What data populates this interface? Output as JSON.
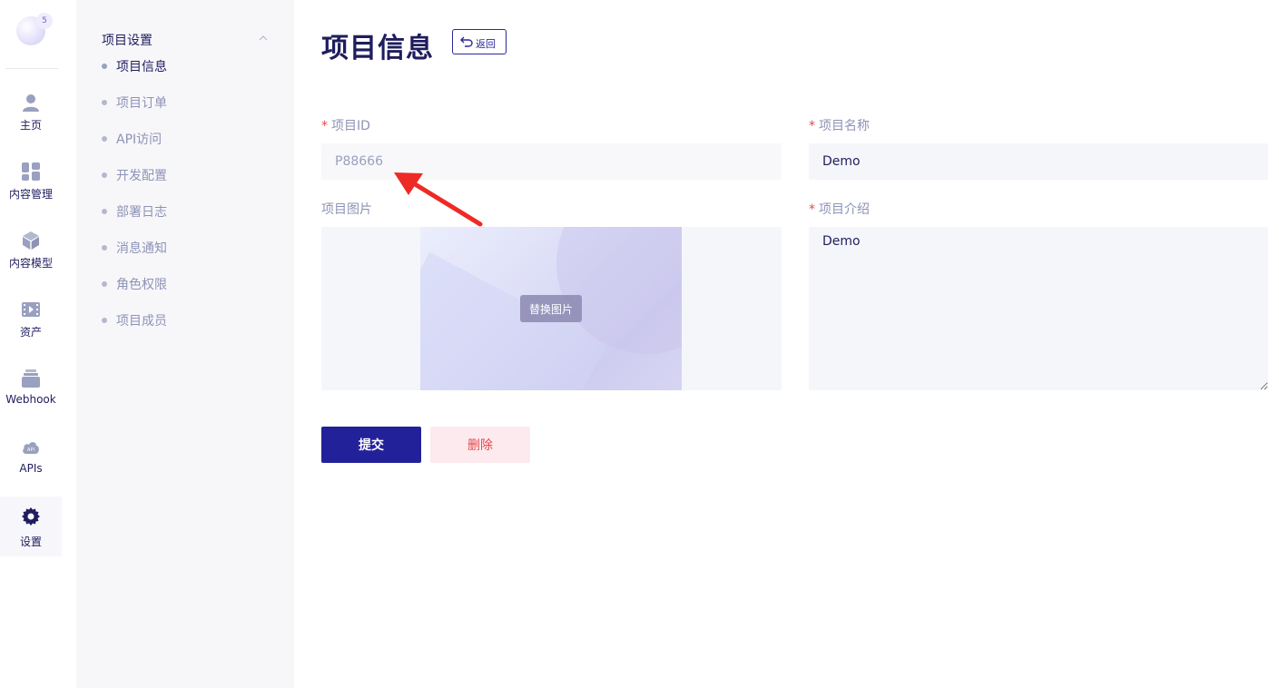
{
  "rail": {
    "avatar_badge": "5",
    "items": [
      {
        "label": "主页",
        "icon": "user-icon"
      },
      {
        "label": "内容管理",
        "icon": "grid-icon"
      },
      {
        "label": "内容模型",
        "icon": "cube-icon"
      },
      {
        "label": "资产",
        "icon": "media-icon"
      },
      {
        "label": "Webhook",
        "icon": "stack-icon"
      },
      {
        "label": "APIs",
        "icon": "cloud-api-icon"
      },
      {
        "label": "设置",
        "icon": "gear-icon"
      }
    ]
  },
  "submenu": {
    "title": "项目设置",
    "items": [
      {
        "label": "项目信息"
      },
      {
        "label": "项目订单"
      },
      {
        "label": "API访问"
      },
      {
        "label": "开发配置"
      },
      {
        "label": "部署日志"
      },
      {
        "label": "消息通知"
      },
      {
        "label": "角色权限"
      },
      {
        "label": "项目成员"
      }
    ]
  },
  "main": {
    "title": "项目信息",
    "back_label": "返回",
    "form": {
      "project_id_label": "项目ID",
      "project_id_value": "P88666",
      "project_name_label": "项目名称",
      "project_name_value": "Demo",
      "project_image_label": "项目图片",
      "replace_image_label": "替换图片",
      "project_desc_label": "项目介绍",
      "project_desc_value": "Demo",
      "required_mark": "*"
    },
    "submit_label": "提交",
    "delete_label": "删除"
  },
  "colors": {
    "accent": "#23219a",
    "danger": "#e5484d",
    "annotation_arrow": "#ee2a24"
  }
}
